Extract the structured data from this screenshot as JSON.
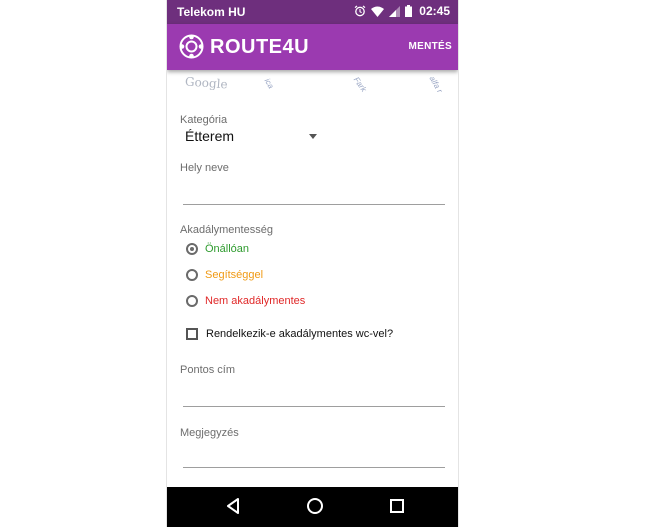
{
  "status_bar": {
    "carrier": "Telekom HU",
    "time": "02:45"
  },
  "app_bar": {
    "title": "ROUTE4U",
    "save_label": "MENTÉS"
  },
  "map": {
    "google_mark": "Google",
    "street_labels": [
      "ica",
      "Fark",
      "alfa r"
    ]
  },
  "form": {
    "category": {
      "label": "Kategória",
      "value": "Étterem"
    },
    "place_name": {
      "label": "Hely neve",
      "value": ""
    },
    "accessibility": {
      "label": "Akadálymentesség",
      "options": [
        {
          "label": "Önállóan",
          "color": "#2e9b2e",
          "checked": true
        },
        {
          "label": "Segítséggel",
          "color": "#f09a14",
          "checked": false
        },
        {
          "label": "Nem akadálymentes",
          "color": "#e02828",
          "checked": false
        }
      ]
    },
    "wc_checkbox": {
      "label": "Rendelkezik-e akadálymentes wc-vel?",
      "checked": false
    },
    "exact_address": {
      "label": "Pontos cím",
      "value": ""
    },
    "note": {
      "label": "Megjegyzés",
      "value": ""
    }
  },
  "colors": {
    "status_bar": "#6e2f7d",
    "app_bar": "#9b3ab0"
  }
}
